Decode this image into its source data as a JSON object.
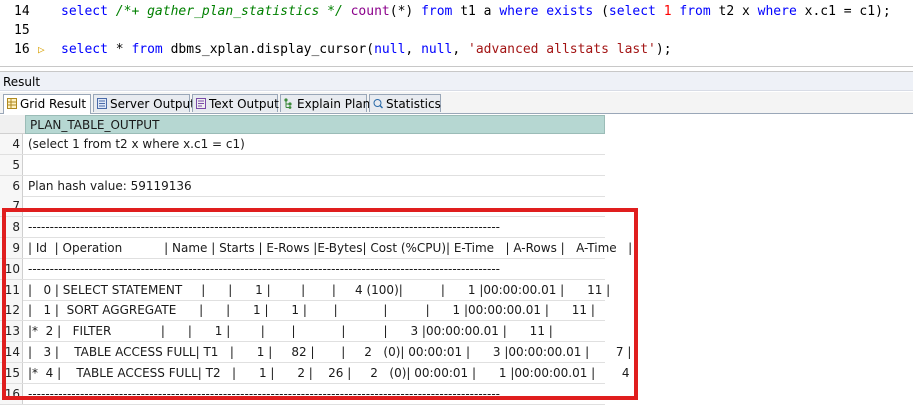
{
  "editor": {
    "lines": [
      {
        "num": "14",
        "parts": [
          {
            "t": "select ",
            "c": "kw"
          },
          {
            "t": "/*+ gather_plan_statistics */ ",
            "c": "cm"
          },
          {
            "t": "count",
            "c": "fn"
          },
          {
            "t": "(*) ",
            "c": ""
          },
          {
            "t": "from",
            "c": "kw"
          },
          {
            "t": " t1 a ",
            "c": ""
          },
          {
            "t": "where exists",
            "c": "kw"
          },
          {
            "t": " (",
            "c": ""
          },
          {
            "t": "select",
            "c": "kw"
          },
          {
            "t": " ",
            "c": ""
          },
          {
            "t": "1",
            "c": "num"
          },
          {
            "t": " ",
            "c": ""
          },
          {
            "t": "from",
            "c": "kw"
          },
          {
            "t": " t2 x ",
            "c": ""
          },
          {
            "t": "where",
            "c": "kw"
          },
          {
            "t": " x.c1 = c1);",
            "c": ""
          }
        ]
      },
      {
        "num": "15",
        "parts": []
      },
      {
        "num": "16",
        "marker": "▷",
        "parts": [
          {
            "t": "select",
            "c": "kw"
          },
          {
            "t": " * ",
            "c": ""
          },
          {
            "t": "from",
            "c": "kw"
          },
          {
            "t": " dbms_xplan.display_cursor(",
            "c": ""
          },
          {
            "t": "null",
            "c": "kw"
          },
          {
            "t": ", ",
            "c": ""
          },
          {
            "t": "null",
            "c": "kw"
          },
          {
            "t": ", ",
            "c": ""
          },
          {
            "t": "'advanced allstats last'",
            "c": "str"
          },
          {
            "t": ");",
            "c": ""
          }
        ]
      }
    ]
  },
  "result_label": "Result",
  "tabs": [
    "Grid Result",
    "Server Output",
    "Text Output",
    "Explain Plan",
    "Statistics"
  ],
  "grid": {
    "column_header": "PLAN_TABLE_OUTPUT",
    "rows": [
      {
        "n": "4",
        "text": "(select 1 from t2 x where x.c1 = c1)"
      },
      {
        "n": "5",
        "text": ""
      },
      {
        "n": "6",
        "text": "Plan hash value: 59119136"
      },
      {
        "n": "7",
        "text": ""
      },
      {
        "n": "8",
        "text": "-------------------------------------------------------------------------------------------------------------"
      },
      {
        "n": "9",
        "text": "| Id  | Operation           | Name | Starts | E-Rows |E-Bytes| Cost (%CPU)| E-Time   | A-Rows |   A-Time   |"
      },
      {
        "n": "10",
        "text": "-------------------------------------------------------------------------------------------------------------"
      },
      {
        "n": "11",
        "text": "|   0 | SELECT STATEMENT     |      |      1 |        |       |     4 (100)|          |      1 |00:00:00.01 |      11 |"
      },
      {
        "n": "12",
        "text": "|   1 |  SORT AGGREGATE      |      |      1 |      1 |       |            |          |      1 |00:00:00.01 |      11 |"
      },
      {
        "n": "13",
        "text": "|*  2 |   FILTER             |      |      1 |        |       |            |          |      3 |00:00:00.01 |      11 |"
      },
      {
        "n": "14",
        "text": "|   3 |    TABLE ACCESS FULL| T1   |      1 |     82 |       |     2   (0)| 00:00:01 |      3 |00:00:00.01 |       7 |"
      },
      {
        "n": "15",
        "text": "|*  4 |    TABLE ACCESS FULL| T2   |      1 |      2 |    26 |     2   (0)| 00:00:01 |      1 |00:00:00.01 |       4 |"
      },
      {
        "n": "16",
        "text": "-------------------------------------------------------------------------------------------------------------"
      }
    ]
  },
  "colors": {
    "highlight": "#e01e1e",
    "header_bg": "#b6d7d2"
  }
}
